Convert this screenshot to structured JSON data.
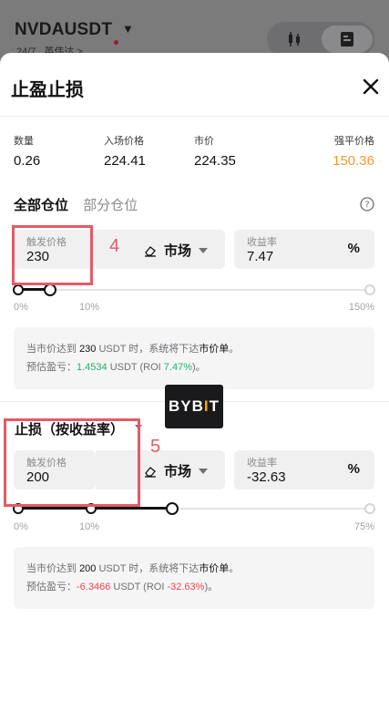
{
  "background": {
    "symbol": "NVDAUSDT",
    "sub_247": "24/7",
    "sub_name": "英伟达 >"
  },
  "sheet": {
    "title": "止盈止损"
  },
  "stats": {
    "qty_label": "数量",
    "qty_value": "0.26",
    "entry_label": "入场价格",
    "entry_value": "224.41",
    "mark_label": "市价",
    "mark_value": "224.35",
    "liq_label": "强平价格",
    "liq_value": "150.36"
  },
  "tabs": {
    "full": "全部仓位",
    "partial": "部分仓位"
  },
  "take_profit": {
    "trigger_label": "触发价格",
    "trigger_value": "230",
    "order_type": "市场",
    "roi_label": "收益率",
    "roi_value": "7.47",
    "roi_unit": "%",
    "slider": {
      "fill_fraction": 0.1,
      "labels": [
        "0%",
        "10%",
        "150%"
      ]
    },
    "info_line1_a": "当市价达到 ",
    "info_line1_price": "230",
    "info_line1_b": " USDT 时，系统将下达",
    "info_line1_order": "市价单",
    "info_line1_c": "。",
    "info_line2_a": "预估盈亏：",
    "info_line2_pnl": "1.4534",
    "info_line2_b": " USDT (ROI ",
    "info_line2_roi": "7.47%",
    "info_line2_c": ")。"
  },
  "stop_loss": {
    "heading": "止损（按收益率）",
    "trigger_label": "触发价格",
    "trigger_value": "200",
    "order_type": "市场",
    "roi_label": "收益率",
    "roi_value": "-32.63",
    "roi_unit": "%",
    "slider": {
      "fill_fraction": 0.44,
      "labels": [
        "0%",
        "10%",
        "75%"
      ]
    },
    "info_line1_a": "当市价达到 ",
    "info_line1_price": "200",
    "info_line1_b": " USDT 时，系统将下达",
    "info_line1_order": "市价单",
    "info_line1_c": "。",
    "info_line2_a": "预估盈亏：",
    "info_line2_pnl": "-6.3466",
    "info_line2_b": " USDT (ROI ",
    "info_line2_roi": "-32.63%",
    "info_line2_c": ")。"
  },
  "annotations": {
    "tp_number": "4",
    "sl_number": "5"
  },
  "watermark": {
    "text_a": "BYB",
    "text_b": "I",
    "text_c": "T"
  },
  "colors": {
    "accent_orange": "#f19a2e",
    "profit_green": "#20b26c",
    "loss_red": "#ef454a",
    "annotation_red": "#e35b65"
  }
}
